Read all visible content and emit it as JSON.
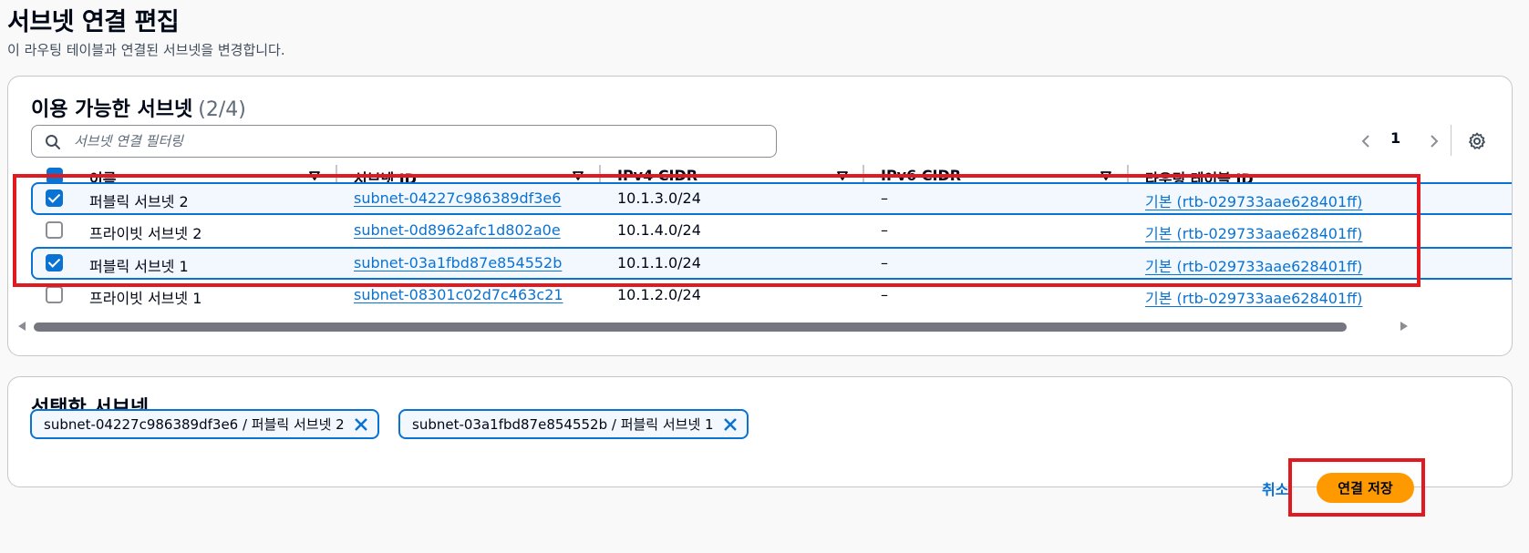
{
  "page": {
    "title": "서브넷 연결 편집",
    "description": "이 라우팅 테이블과 연결된 서브넷을 변경합니다."
  },
  "available": {
    "title": "이용 가능한 서브넷",
    "count": "(2/4)",
    "search_placeholder": "서브넷 연결 필터링",
    "page_number": "1",
    "columns": [
      "이름",
      "서브넷 ID",
      "IPv4 CIDR",
      "IPv6 CIDR",
      "라우팅 테이블 ID"
    ],
    "rows": [
      {
        "selected": true,
        "name": "퍼블릭 서브넷 2",
        "subnet_id": "subnet-04227c986389df3e6",
        "ipv4": "10.1.3.0/24",
        "ipv6": "–",
        "route_table": "기본 (rtb-029733aae628401ff)"
      },
      {
        "selected": false,
        "name": "프라이빗 서브넷 2",
        "subnet_id": "subnet-0d8962afc1d802a0e",
        "ipv4": "10.1.4.0/24",
        "ipv6": "–",
        "route_table": "기본 (rtb-029733aae628401ff)"
      },
      {
        "selected": true,
        "name": "퍼블릭 서브넷 1",
        "subnet_id": "subnet-03a1fbd87e854552b",
        "ipv4": "10.1.1.0/24",
        "ipv6": "–",
        "route_table": "기본 (rtb-029733aae628401ff)"
      },
      {
        "selected": false,
        "name": "프라이빗 서브넷 1",
        "subnet_id": "subnet-08301c02d7c463c21",
        "ipv4": "10.1.2.0/24",
        "ipv6": "–",
        "route_table": "기본 (rtb-029733aae628401ff)"
      }
    ]
  },
  "selected": {
    "title": "선택한 서브넷",
    "tokens": [
      "subnet-04227c986389df3e6 / 퍼블릭 서브넷 2",
      "subnet-03a1fbd87e854552b / 퍼블릭 서브넷 1"
    ]
  },
  "footer": {
    "cancel_label": "취소",
    "save_label": "연결 저장"
  },
  "colors": {
    "accent": "#0972d3",
    "primary_button": "#ff9900",
    "highlight": "#e11a22"
  }
}
